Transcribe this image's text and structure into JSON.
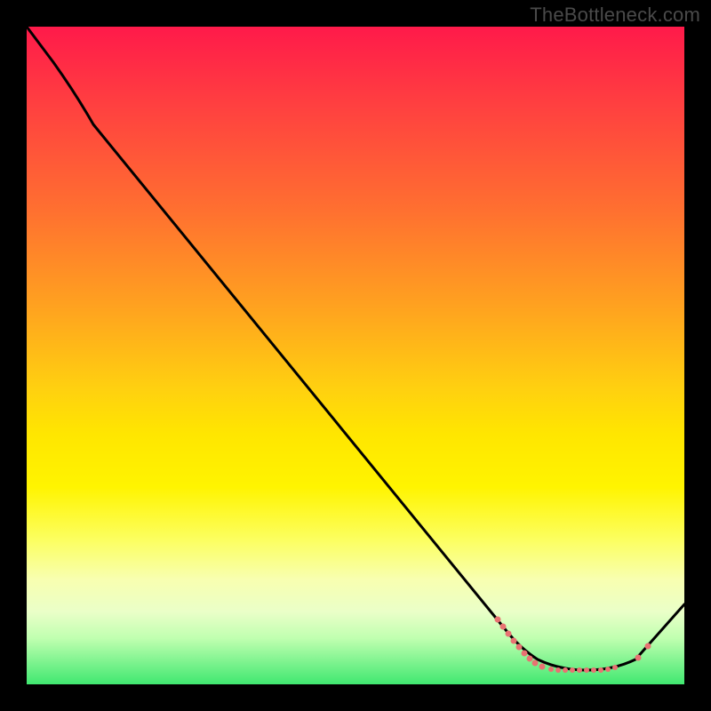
{
  "watermark": "TheBottleneck.com",
  "chart_data": {
    "type": "line",
    "title": "",
    "xlabel": "",
    "ylabel": "",
    "xlim": [
      0,
      100
    ],
    "ylim": [
      0,
      100
    ],
    "grid": false,
    "legend": false,
    "background": {
      "type": "vertical-gradient",
      "stops": [
        {
          "pos": 0.0,
          "color": "#ff1a4a"
        },
        {
          "pos": 0.12,
          "color": "#ff4040"
        },
        {
          "pos": 0.28,
          "color": "#ff7030"
        },
        {
          "pos": 0.42,
          "color": "#ffa020"
        },
        {
          "pos": 0.55,
          "color": "#ffd010"
        },
        {
          "pos": 0.62,
          "color": "#ffe600"
        },
        {
          "pos": 0.7,
          "color": "#fff400"
        },
        {
          "pos": 0.78,
          "color": "#fcff60"
        },
        {
          "pos": 0.84,
          "color": "#f8ffb0"
        },
        {
          "pos": 0.89,
          "color": "#eaffc8"
        },
        {
          "pos": 0.93,
          "color": "#c0ffb0"
        },
        {
          "pos": 1.0,
          "color": "#40e870"
        }
      ]
    },
    "series": [
      {
        "name": "bottleneck-curve",
        "color": "#000000",
        "x": [
          0,
          4,
          10,
          20,
          30,
          40,
          50,
          60,
          68,
          73,
          78,
          82,
          86,
          90,
          93,
          100
        ],
        "y": [
          100,
          95,
          85,
          72,
          60,
          47,
          34,
          22,
          12,
          8,
          4,
          2,
          2,
          4,
          6,
          12
        ]
      }
    ],
    "highlight_points": {
      "name": "optimum-region",
      "color": "#e87272",
      "x": [
        71,
        72,
        73,
        74,
        75,
        76,
        77,
        78,
        79,
        80,
        81,
        82,
        83,
        84,
        85,
        86,
        87,
        88,
        89,
        90,
        93,
        95
      ],
      "y": [
        10,
        9,
        8,
        7,
        6,
        5,
        4,
        3,
        3,
        2,
        2,
        2,
        2,
        2,
        2,
        2,
        2,
        2,
        3,
        4,
        6,
        7
      ]
    },
    "annotations": [
      {
        "text": "TheBottleneck.com",
        "position": "top-right",
        "color": "#4a4a4a"
      }
    ]
  }
}
